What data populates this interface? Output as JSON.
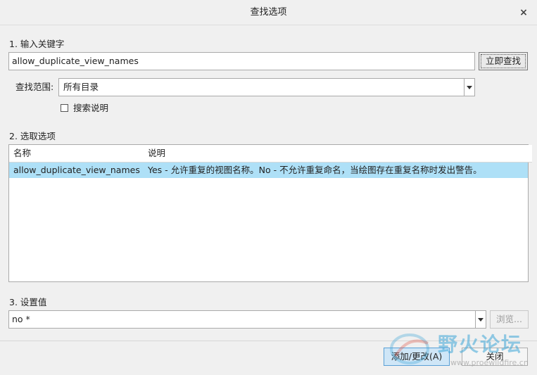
{
  "window": {
    "title": "查找选项",
    "close_glyph": "×"
  },
  "step1": {
    "label": "1.  输入关键字",
    "keyword_value": "allow_duplicate_view_names",
    "search_button": "立即查找",
    "scope_label": "查找范围:",
    "scope_value": "所有目录",
    "search_desc_label": "搜索说明",
    "search_desc_checked": false
  },
  "step2": {
    "label": "2.  选取选项",
    "columns": [
      "名称",
      "说明"
    ],
    "rows": [
      {
        "name": "allow_duplicate_view_names",
        "description": "Yes - 允许重复的视图名称。No - 不允许重复命名，当绘图存在重复名称时发出警告。"
      }
    ]
  },
  "step3": {
    "label": "3.  设置值",
    "value": "no *",
    "browse_button": "浏览..."
  },
  "footer": {
    "add_button": "添加/更改(A)",
    "close_button": "关闭"
  },
  "watermark": {
    "text": "野火论坛",
    "url": "www.proewildfire.cn"
  },
  "colors": {
    "selection": "#aee0f7",
    "watermark": "#3fa7d8"
  }
}
